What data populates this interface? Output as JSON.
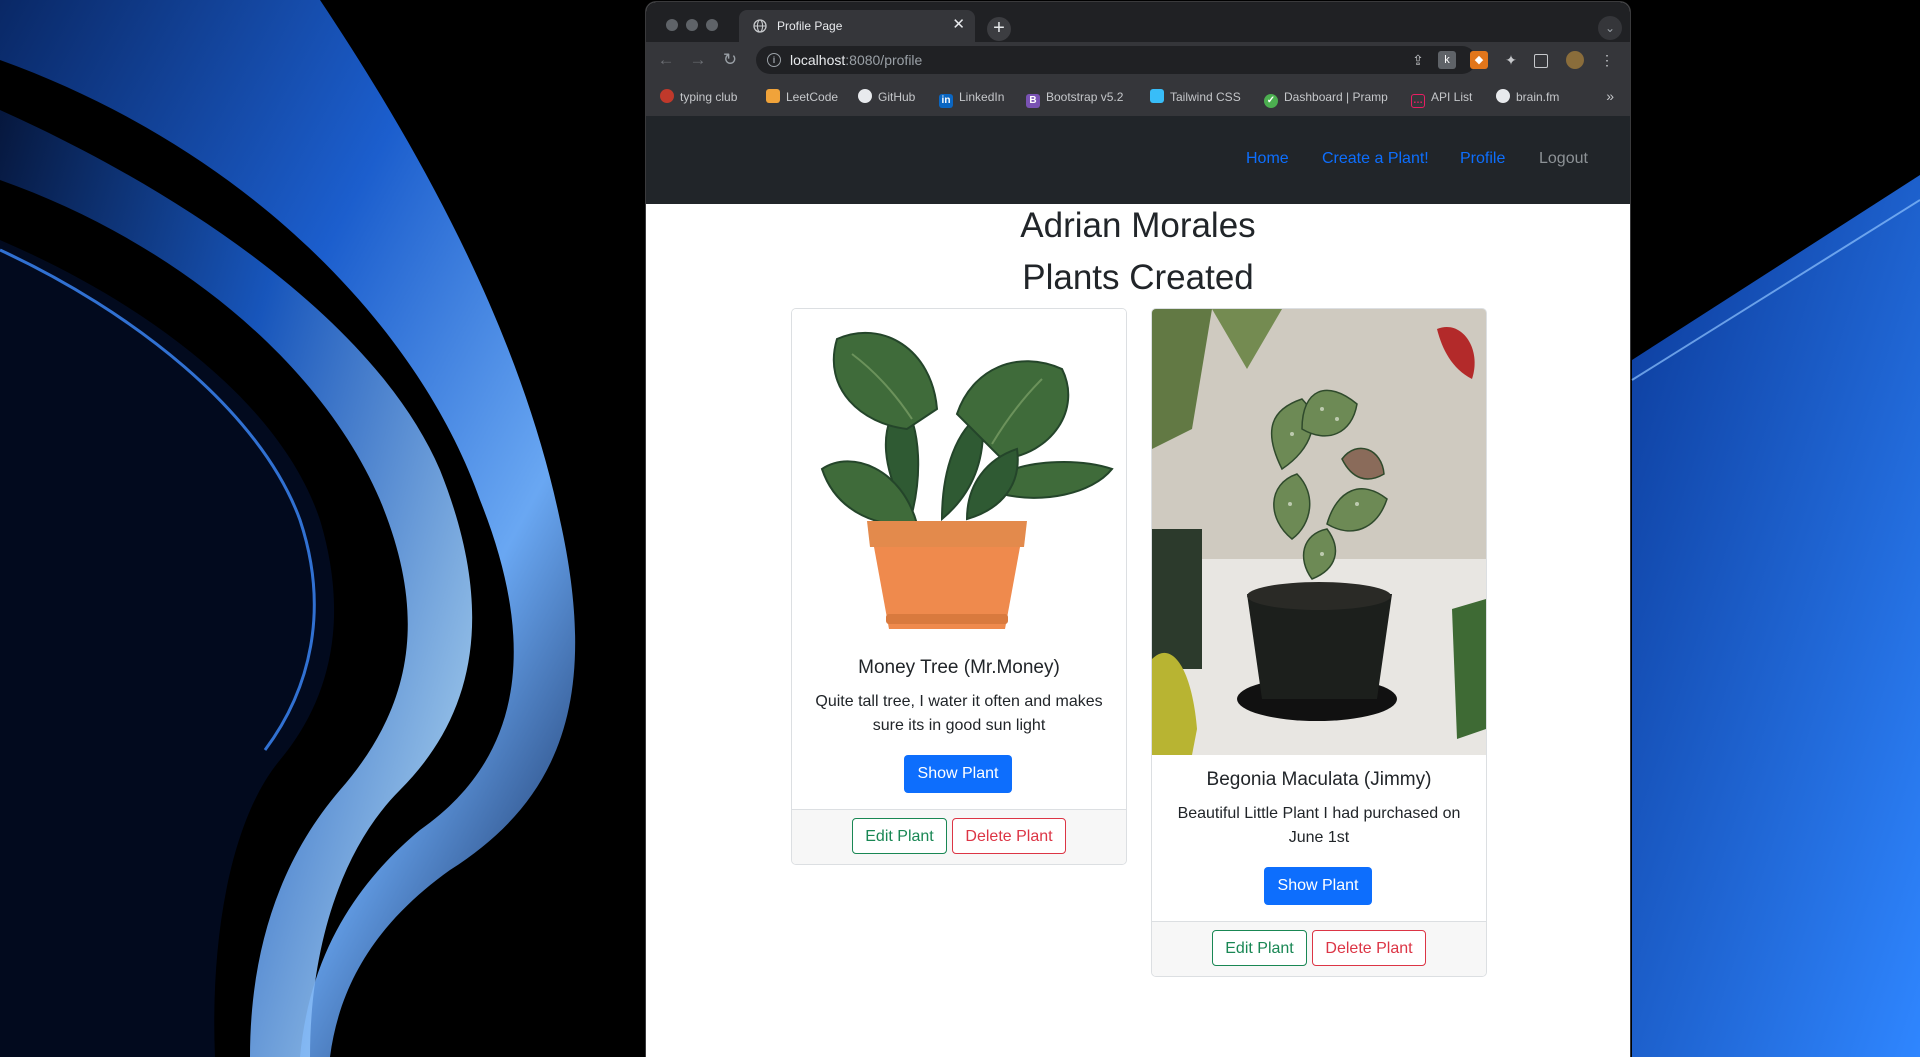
{
  "browser": {
    "tab_title": "Profile Page",
    "url_host": "localhost",
    "url_path": ":8080/profile"
  },
  "bookmarks": [
    {
      "label": "typing club",
      "icon": "typing-club-icon",
      "color": "#c0392b"
    },
    {
      "label": "LeetCode",
      "icon": "leetcode-icon",
      "color": "#f0a33a"
    },
    {
      "label": "GitHub",
      "icon": "github-icon",
      "color": "#e8eaed"
    },
    {
      "label": "LinkedIn",
      "icon": "linkedin-icon",
      "color": "#0a66c2"
    },
    {
      "label": "Bootstrap v5.2",
      "icon": "bootstrap-icon",
      "color": "#7952b3"
    },
    {
      "label": "Tailwind CSS",
      "icon": "tailwind-icon",
      "color": "#38bdf8"
    },
    {
      "label": "Dashboard | Pramp",
      "icon": "pramp-icon",
      "color": "#4caf50"
    },
    {
      "label": "API List",
      "icon": "api-list-icon",
      "color": "#e91e63"
    },
    {
      "label": "brain.fm",
      "icon": "brainfm-icon",
      "color": "#e8eaed"
    }
  ],
  "nav": {
    "home": "Home",
    "create": "Create a Plant!",
    "profile": "Profile",
    "logout": "Logout"
  },
  "profile": {
    "name": "Adrian Morales",
    "section_title": "Plants Created"
  },
  "plants": [
    {
      "title": "Money Tree (Mr.Money)",
      "description": "Quite tall tree, I water it often and makes sure its in good sun light",
      "show_label": "Show Plant",
      "edit_label": "Edit Plant",
      "delete_label": "Delete Plant"
    },
    {
      "title": "Begonia Maculata (Jimmy)",
      "description": "Beautiful Little Plant I had purchased on June 1st",
      "show_label": "Show Plant",
      "edit_label": "Edit Plant",
      "delete_label": "Delete Plant"
    }
  ],
  "colors": {
    "primary": "#0d6efd",
    "success": "#198754",
    "danger": "#dc3545",
    "navbar": "#212529"
  }
}
